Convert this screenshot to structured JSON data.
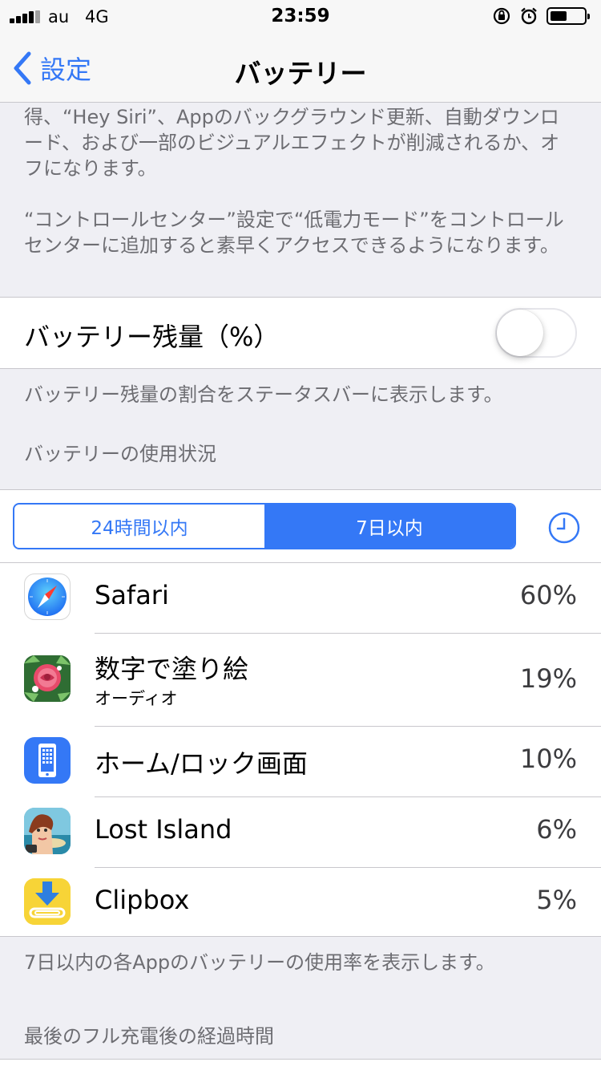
{
  "status_bar": {
    "carrier": "au",
    "network": "4G",
    "time": "23:59",
    "battery_level": 0.52
  },
  "nav": {
    "back_label": "設定",
    "title": "バッテリー"
  },
  "low_power_description": {
    "lines": [
      "得、“Hey Siri”、Appのバックグラウンド更新、自動ダウンロ",
      "ード、および一部のビジュアルエフェクトが削減されるか、オ",
      "フになります。"
    ],
    "control_center_lines": [
      "“コントロールセンター”設定で“低電力モード”をコントロール",
      "センターに追加すると素早くアクセスできるようになります。"
    ]
  },
  "battery_percentage": {
    "label": "バッテリー残量（%）",
    "enabled": false,
    "footer": "バッテリー残量の割合をステータスバーに表示します。"
  },
  "usage": {
    "section_header": "バッテリーの使用状況",
    "segments": [
      "24時間以内",
      "7日以内"
    ],
    "selected_segment": 1,
    "apps": [
      {
        "name": "Safari",
        "subtitle": "",
        "percent": "60%",
        "icon": "safari-icon"
      },
      {
        "name": "数字で塗り絵",
        "subtitle": "オーディオ",
        "percent": "19%",
        "icon": "rose-coloring-icon"
      },
      {
        "name": "ホーム/ロック画面",
        "subtitle": "",
        "percent": "10%",
        "icon": "phone-screen-icon"
      },
      {
        "name": "Lost Island",
        "subtitle": "",
        "percent": "6%",
        "icon": "lost-island-icon"
      },
      {
        "name": "Clipbox",
        "subtitle": "",
        "percent": "5%",
        "icon": "clipbox-icon"
      }
    ],
    "footer": "7日以内の各Appのバッテリーの使用率を表示します。"
  },
  "time_since_charge": {
    "section_header": "最後のフル充電後の経過時間"
  },
  "colors": {
    "accent": "#3478f6",
    "background": "#efeff4"
  }
}
